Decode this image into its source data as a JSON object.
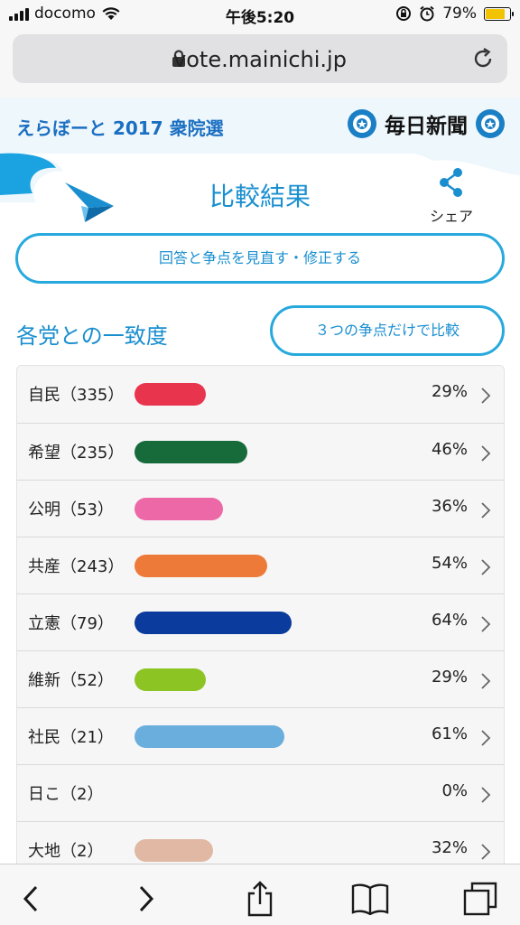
{
  "status_bar": {
    "carrier": "docomo",
    "time": "午後5:20",
    "battery_percent_text": "79%",
    "battery_level": 0.79
  },
  "browser": {
    "url": "vote.mainichi.jp"
  },
  "site": {
    "title": "えらぼーと 2017 衆院選",
    "logo_text": "毎日新聞"
  },
  "page": {
    "title": "比較結果",
    "share_label": "シェア",
    "revise_button": "回答と争点を見直す・修正する",
    "section_label": "各党との一致度",
    "compare_button": "３つの争点だけで比較"
  },
  "parties": [
    {
      "name": "自民（335）",
      "percent_text": "29%",
      "value": 29,
      "color": "#e8344d"
    },
    {
      "name": "希望（235）",
      "percent_text": "46%",
      "value": 46,
      "color": "#176b3a"
    },
    {
      "name": "公明（53）",
      "percent_text": "36%",
      "value": 36,
      "color": "#ec68a6"
    },
    {
      "name": "共産（243）",
      "percent_text": "54%",
      "value": 54,
      "color": "#ee7a3a"
    },
    {
      "name": "立憲（79）",
      "percent_text": "64%",
      "value": 64,
      "color": "#0b3b9c"
    },
    {
      "name": "維新（52）",
      "percent_text": "29%",
      "value": 29,
      "color": "#8cc424"
    },
    {
      "name": "社民（21）",
      "percent_text": "61%",
      "value": 61,
      "color": "#6aaede"
    },
    {
      "name": "日こ（2）",
      "percent_text": "0%",
      "value": 0,
      "color": "#cccccc"
    },
    {
      "name": "大地（2）",
      "percent_text": "32%",
      "value": 32,
      "color": "#e0b8a4"
    }
  ],
  "colors": {
    "accent": "#28a9de",
    "accent_text": "#1a8fd0",
    "site_title": "#1b6fc2"
  },
  "icons": {
    "back": "chevron-left-icon",
    "forward": "chevron-right-icon",
    "share": "share-icon",
    "bookmarks": "book-icon",
    "tabs": "tabs-icon"
  }
}
